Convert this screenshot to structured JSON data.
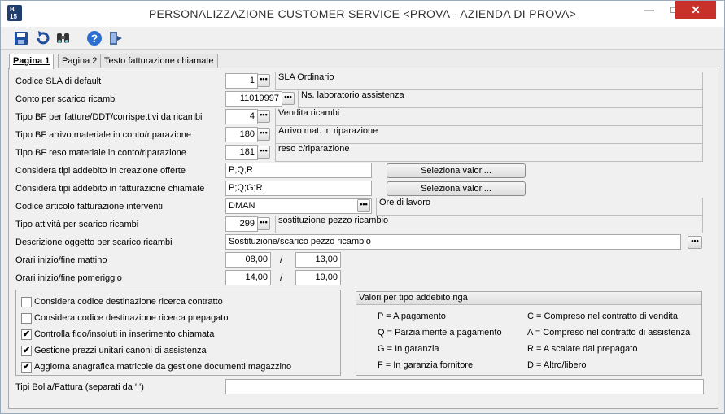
{
  "window": {
    "app_icon": "B\n15",
    "title": "PERSONALIZZAZIONE CUSTOMER SERVICE <PROVA - AZIENDA DI PROVA>"
  },
  "toolbar": {
    "icons": [
      "save-icon",
      "undo-icon",
      "find-icon",
      "help-icon",
      "exit-icon"
    ]
  },
  "tabs": [
    "Pagina 1",
    "Pagina 2",
    "Testo fatturazione chiamate"
  ],
  "fields": {
    "sla": {
      "label": "Codice SLA di default",
      "value": "1",
      "desc": "SLA Ordinario"
    },
    "conto": {
      "label": "Conto per scarico ricambi",
      "value": "11019997",
      "desc": "Ns. laboratorio assistenza"
    },
    "bf_fatture": {
      "label": "Tipo BF per fatture/DDT/corrispettivi da ricambi",
      "value": "4",
      "desc": "Vendita ricambi"
    },
    "bf_arrivo": {
      "label": "Tipo BF arrivo materiale in conto/riparazione",
      "value": "180",
      "desc": "Arrivo mat. in riparazione"
    },
    "bf_reso": {
      "label": "Tipo BF reso materiale in conto/riparazione",
      "value": "181",
      "desc": "reso c/riparazione"
    },
    "addebito_offerte": {
      "label": "Considera tipi addebito in creazione offerte",
      "value": "P;Q;R",
      "button": "Seleziona valori..."
    },
    "addebito_fatt": {
      "label": "Considera tipi addebito in fatturazione chiamate",
      "value": "P;Q;G;R",
      "button": "Seleziona valori..."
    },
    "articolo": {
      "label": "Codice articolo fatturazione interventi",
      "value": "DMAN",
      "desc": "Ore di lavoro"
    },
    "attivita": {
      "label": "Tipo attività per scarico ricambi",
      "value": "299",
      "desc": "sostituzione pezzo ricambio"
    },
    "descrizione": {
      "label": "Descrizione oggetto per scarico ricambi",
      "value": "Sostituzione/scarico pezzo ricambio"
    },
    "mattino": {
      "label": "Orari inizio/fine mattino",
      "from": "08,00",
      "to": "13,00"
    },
    "pomeriggio": {
      "label": "Orari inizio/fine pomeriggio",
      "from": "14,00",
      "to": "19,00"
    },
    "bolla": {
      "label": "Tipi Bolla/Fattura (separati da ';')",
      "value": ""
    }
  },
  "dots": "•••",
  "slash": "/",
  "checks": [
    {
      "label": "Considera codice destinazione ricerca contratto",
      "checked": false
    },
    {
      "label": "Considera codice destinazione ricerca prepagato",
      "checked": false
    },
    {
      "label": "Controlla fido/insoluti in inserimento chiamata",
      "checked": true
    },
    {
      "label": "Gestione prezzi unitari canoni di assistenza",
      "checked": true
    },
    {
      "label": "Aggiorna anagrafica matricole da gestione documenti magazzino",
      "checked": true
    }
  ],
  "check_mark": "✔",
  "legend": {
    "title": "Valori per tipo addebito riga",
    "left": [
      "P = A pagamento",
      "Q = Parzialmente a pagamento",
      "G = In garanzia",
      "F = In garanzia fornitore"
    ],
    "right": [
      "C = Compreso nel contratto di vendita",
      "A = Compreso nel contratto di assistenza",
      "R = A scalare dal prepagato",
      "D = Altro/libero"
    ]
  }
}
